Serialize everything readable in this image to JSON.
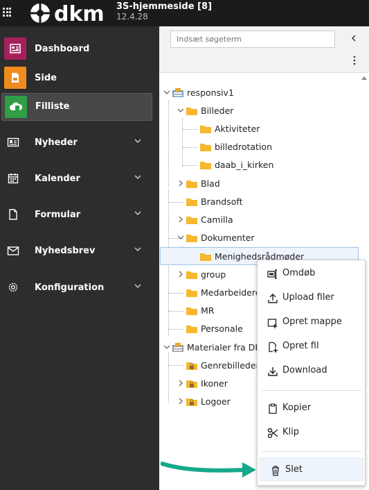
{
  "header": {
    "title": "3S-hjemmeside [8]",
    "version": "12.4.28",
    "logo_text": "dkm"
  },
  "sidebar": {
    "items": [
      {
        "label": "Dashboard",
        "icon": "dashboard-icon",
        "color": "#a8205b"
      },
      {
        "label": "Side",
        "icon": "page-icon",
        "color": "#f08c1e"
      },
      {
        "label": "Filliste",
        "icon": "cloud-icon",
        "color": "#2f9e45",
        "active": true
      },
      {
        "label": "Nyheder",
        "icon": "newspaper-icon",
        "expandable": true
      },
      {
        "label": "Kalender",
        "icon": "calendar-icon",
        "expandable": true
      },
      {
        "label": "Formular",
        "icon": "form-icon",
        "expandable": true
      },
      {
        "label": "Nyhedsbrev",
        "icon": "envelope-icon",
        "expandable": true
      },
      {
        "label": "Konfiguration",
        "icon": "gear-icon",
        "expandable": true
      }
    ]
  },
  "tree": {
    "search_placeholder": "Indsæt søgeterm",
    "nodes": [
      {
        "label": "responsiv1",
        "type": "root"
      },
      {
        "label": "Billeder",
        "type": "folder",
        "expanded": true
      },
      {
        "label": "Aktiviteter",
        "type": "folder"
      },
      {
        "label": "billedrotation",
        "type": "folder"
      },
      {
        "label": "daab_i_kirken",
        "type": "folder"
      },
      {
        "label": "Blad",
        "type": "folder",
        "collapsed": true
      },
      {
        "label": "Brandsoft",
        "type": "folder"
      },
      {
        "label": "Camilla",
        "type": "folder",
        "collapsed": true
      },
      {
        "label": "Dokumenter",
        "type": "folder",
        "expanded": true
      },
      {
        "label": "Menighedsrådmøder",
        "type": "folder",
        "selected": true
      },
      {
        "label": "group",
        "type": "folder",
        "collapsed": true
      },
      {
        "label": "Medarbeidere",
        "type": "folder"
      },
      {
        "label": "MR",
        "type": "folder"
      },
      {
        "label": "Personale",
        "type": "folder"
      },
      {
        "label": "Materialer fra DK",
        "type": "root",
        "expanded": true
      },
      {
        "label": "Genrebilleder",
        "type": "locked-folder"
      },
      {
        "label": "Ikoner",
        "type": "locked-folder",
        "collapsed": true
      },
      {
        "label": "Logoer",
        "type": "locked-folder",
        "collapsed": true
      }
    ]
  },
  "context_menu": {
    "items": [
      {
        "label": "Omdøb",
        "icon": "rename-icon"
      },
      {
        "label": "Upload filer",
        "icon": "upload-icon"
      },
      {
        "label": "Opret mappe",
        "icon": "new-folder-icon"
      },
      {
        "label": "Opret fil",
        "icon": "new-file-icon"
      },
      {
        "label": "Download",
        "icon": "download-icon"
      },
      {
        "label": "Kopier",
        "icon": "copy-icon"
      },
      {
        "label": "Klip",
        "icon": "scissors-icon"
      },
      {
        "label": "Slet",
        "icon": "trash-icon",
        "highlighted": true
      }
    ]
  },
  "colors": {
    "folder": "#f5b82e",
    "arrow": "#16a98c",
    "sidebar_bg": "#2d2d2d",
    "topbar_bg": "#1b1b1b"
  }
}
